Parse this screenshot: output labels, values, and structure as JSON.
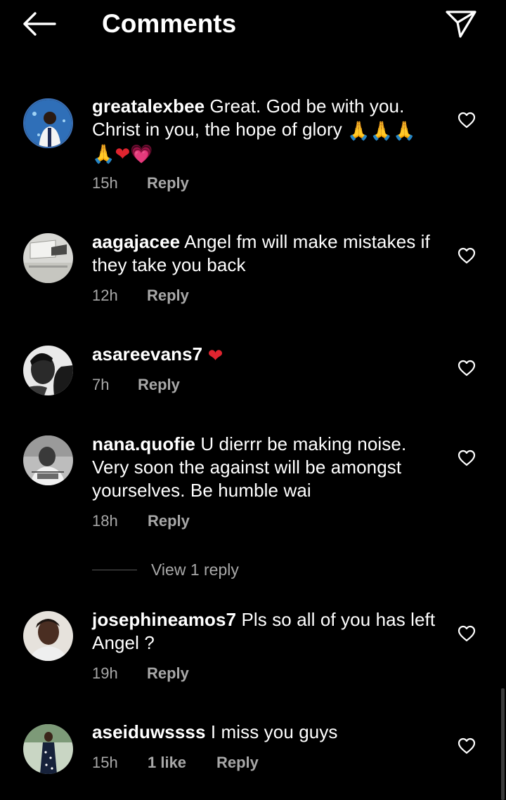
{
  "header": {
    "title": "Comments",
    "back_icon": "arrow-left-icon",
    "share_icon": "paper-plane-icon"
  },
  "comments": [
    {
      "username": "greatalexbee",
      "text": "Great.  God be with you. Christ in you, the hope of glory",
      "emojis_line1": "🙏🙏🙏",
      "emojis_line2_pray": "🙏",
      "emojis_line2_heart": "❤",
      "emojis_line2_pink": "💗",
      "time": "15h",
      "reply": "Reply"
    },
    {
      "username": "aagajacee",
      "text": "Angel fm will make mistakes if they take you back",
      "time": "12h",
      "reply": "Reply"
    },
    {
      "username": "asareevans7",
      "text": "",
      "emoji": "❤",
      "time": "7h",
      "reply": "Reply"
    },
    {
      "username": "nana.quofie",
      "text": "U dierrr be making noise. Very soon the against will be amongst yourselves. Be humble wai",
      "time": "18h",
      "reply": "Reply",
      "view_replies": "View 1 reply"
    },
    {
      "username": "josephineamos7",
      "text": "Pls so all of you has left Angel ?",
      "time": "19h",
      "reply": "Reply"
    },
    {
      "username": "aseiduwssss",
      "text": "I miss you guys",
      "time": "15h",
      "likes": "1 like",
      "reply": "Reply"
    }
  ],
  "colors": {
    "background": "#000000",
    "text": "#ffffff",
    "meta": "#a8a8a8",
    "heart_red": "#e0242f"
  }
}
